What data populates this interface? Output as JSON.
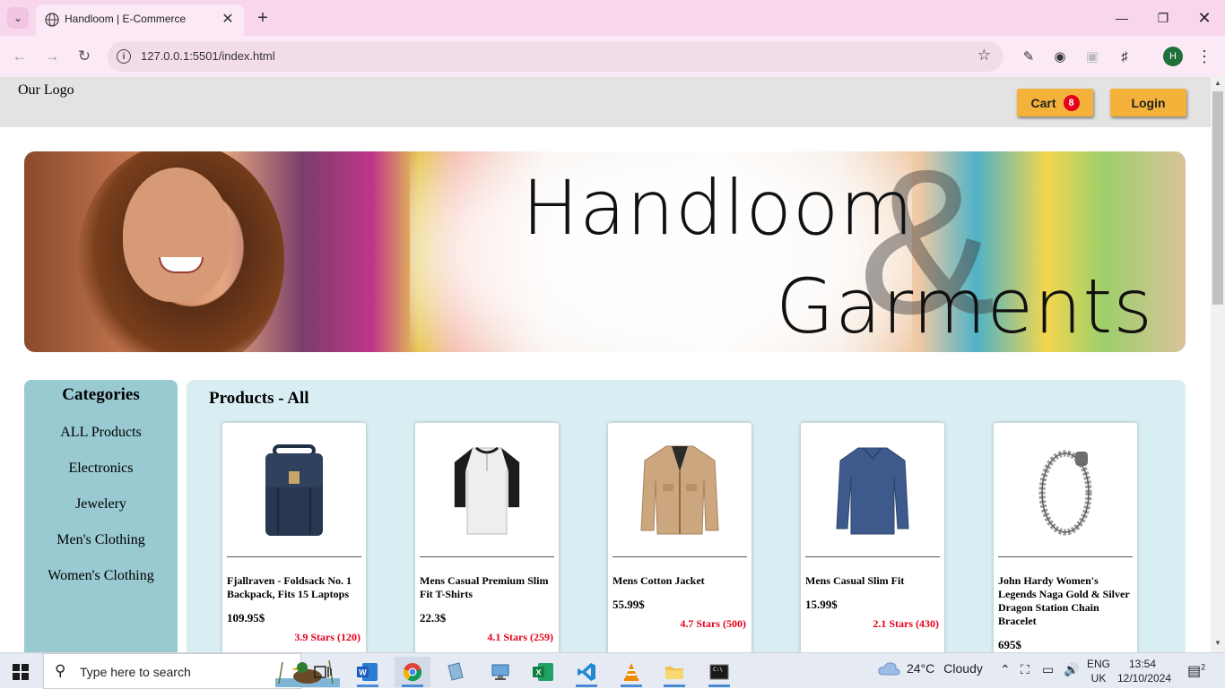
{
  "browser": {
    "tab_title": "Handloom | E-Commerce",
    "url": "127.0.0.1:5501/index.html",
    "profile_initial": "H"
  },
  "header": {
    "logo_text": "Our Logo",
    "cart_label": "Cart",
    "cart_count": "8",
    "login_label": "Login",
    "button_color": "#f4b23a",
    "badge_color": "#e4001c"
  },
  "banner": {
    "title_line1": "Handloom",
    "title_line2": "Garments",
    "ampersand": "&"
  },
  "sidebar": {
    "title": "Categories",
    "items": [
      "ALL Products",
      "Electronics",
      "Jewelery",
      "Men's Clothing",
      "Women's Clothing"
    ],
    "bg_color": "#99c9d1"
  },
  "products": {
    "heading": "Products - All",
    "bg_color": "#d9eef2",
    "items": [
      {
        "name": "Fjallraven - Foldsack No. 1 Backpack, Fits 15 Laptops",
        "price": "109.95$",
        "rating": "3.9 Stars (120)",
        "icon": "backpack-icon"
      },
      {
        "name": "Mens Casual Premium Slim Fit T-Shirts",
        "price": "22.3$",
        "rating": "4.1 Stars (259)",
        "icon": "tshirt-icon"
      },
      {
        "name": "Mens Cotton Jacket",
        "price": "55.99$",
        "rating": "4.7 Stars (500)",
        "icon": "jacket-icon"
      },
      {
        "name": "Mens Casual Slim Fit",
        "price": "15.99$",
        "rating": "2.1 Stars (430)",
        "icon": "longsleeve-shirt-icon"
      },
      {
        "name": "John Hardy Women's Legends Naga Gold & Silver Dragon Station Chain Bracelet",
        "price": "695$",
        "rating": "",
        "icon": "bracelet-icon"
      }
    ]
  },
  "taskbar": {
    "search_placeholder": "Type here to search",
    "weather_temp": "24°C",
    "weather_desc": "Cloudy",
    "lang_line1": "ENG",
    "lang_line2": "UK",
    "time": "13:54",
    "date": "12/10/2024",
    "notifications": "2"
  }
}
